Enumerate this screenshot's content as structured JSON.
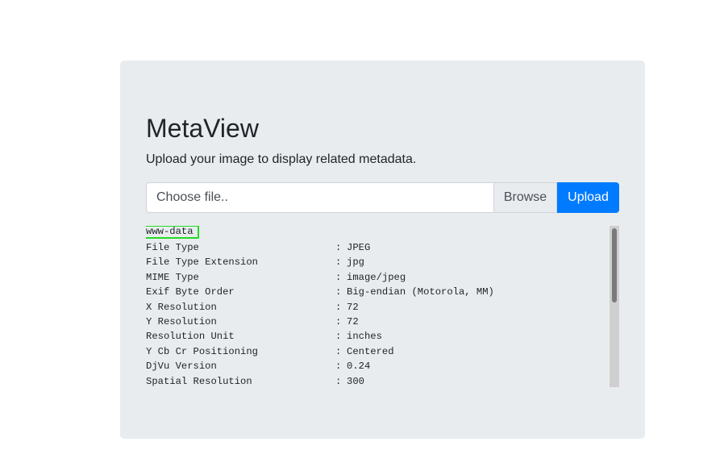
{
  "header": {
    "title": "MetaView",
    "subtitle": "Upload your image to display related metadata."
  },
  "upload": {
    "file_placeholder": "Choose file..",
    "browse_label": "Browse",
    "upload_label": "Upload"
  },
  "output": {
    "user": "www-data",
    "rows": [
      {
        "key": "File Type",
        "sep": ":",
        "value": "JPEG"
      },
      {
        "key": "File Type Extension",
        "sep": ":",
        "value": "jpg"
      },
      {
        "key": "MIME Type",
        "sep": ":",
        "value": "image/jpeg"
      },
      {
        "key": "Exif Byte Order",
        "sep": ":",
        "value": "Big-endian (Motorola, MM)"
      },
      {
        "key": "X Resolution",
        "sep": ":",
        "value": "72"
      },
      {
        "key": "Y Resolution",
        "sep": ":",
        "value": "72"
      },
      {
        "key": "Resolution Unit",
        "sep": ":",
        "value": "inches"
      },
      {
        "key": "Y Cb Cr Positioning",
        "sep": ":",
        "value": "Centered"
      },
      {
        "key": "DjVu Version",
        "sep": ":",
        "value": "0.24"
      },
      {
        "key": "Spatial Resolution",
        "sep": ":",
        "value": "300"
      }
    ]
  },
  "colors": {
    "primary": "#007bff",
    "highlight_border": "#22dd22",
    "panel_background": "#e9ecef"
  }
}
